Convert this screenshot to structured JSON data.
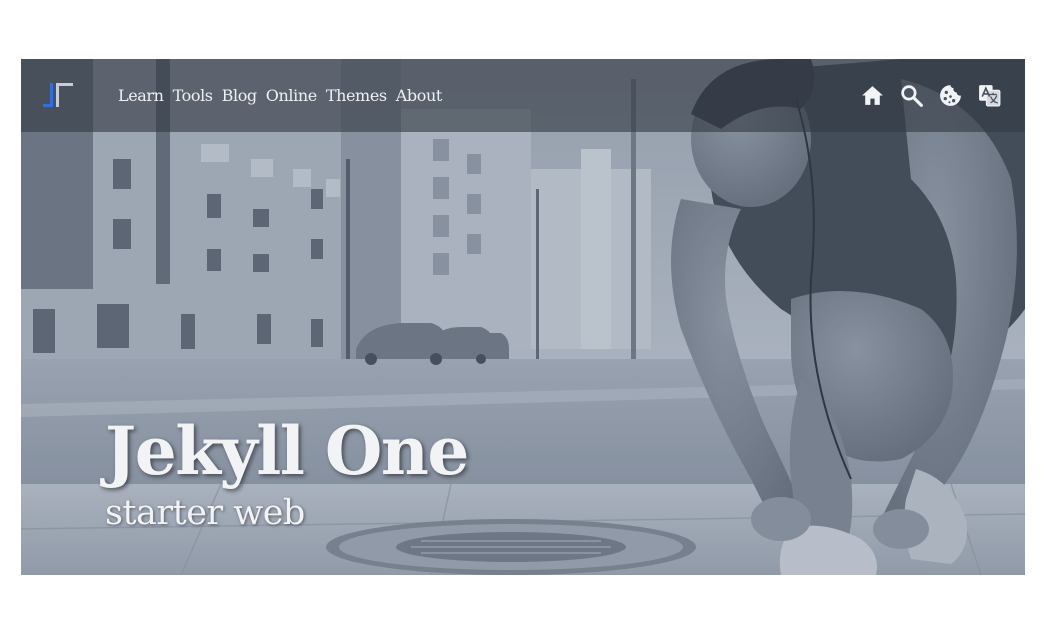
{
  "nav": {
    "items": [
      {
        "label": "Learn"
      },
      {
        "label": "Tools"
      },
      {
        "label": "Blog"
      },
      {
        "label": "Online"
      },
      {
        "label": "Themes"
      },
      {
        "label": "About"
      }
    ],
    "icons": [
      "home-icon",
      "search-icon",
      "cookie-icon",
      "translate-icon"
    ]
  },
  "hero": {
    "title": "Jekyll One",
    "subtitle": "starter web"
  },
  "colors": {
    "navbar_overlay": "#343a44",
    "logo_blue": "#2f6fe0",
    "logo_gray": "#c9ccd2",
    "text_light": "#f2f3f5"
  }
}
